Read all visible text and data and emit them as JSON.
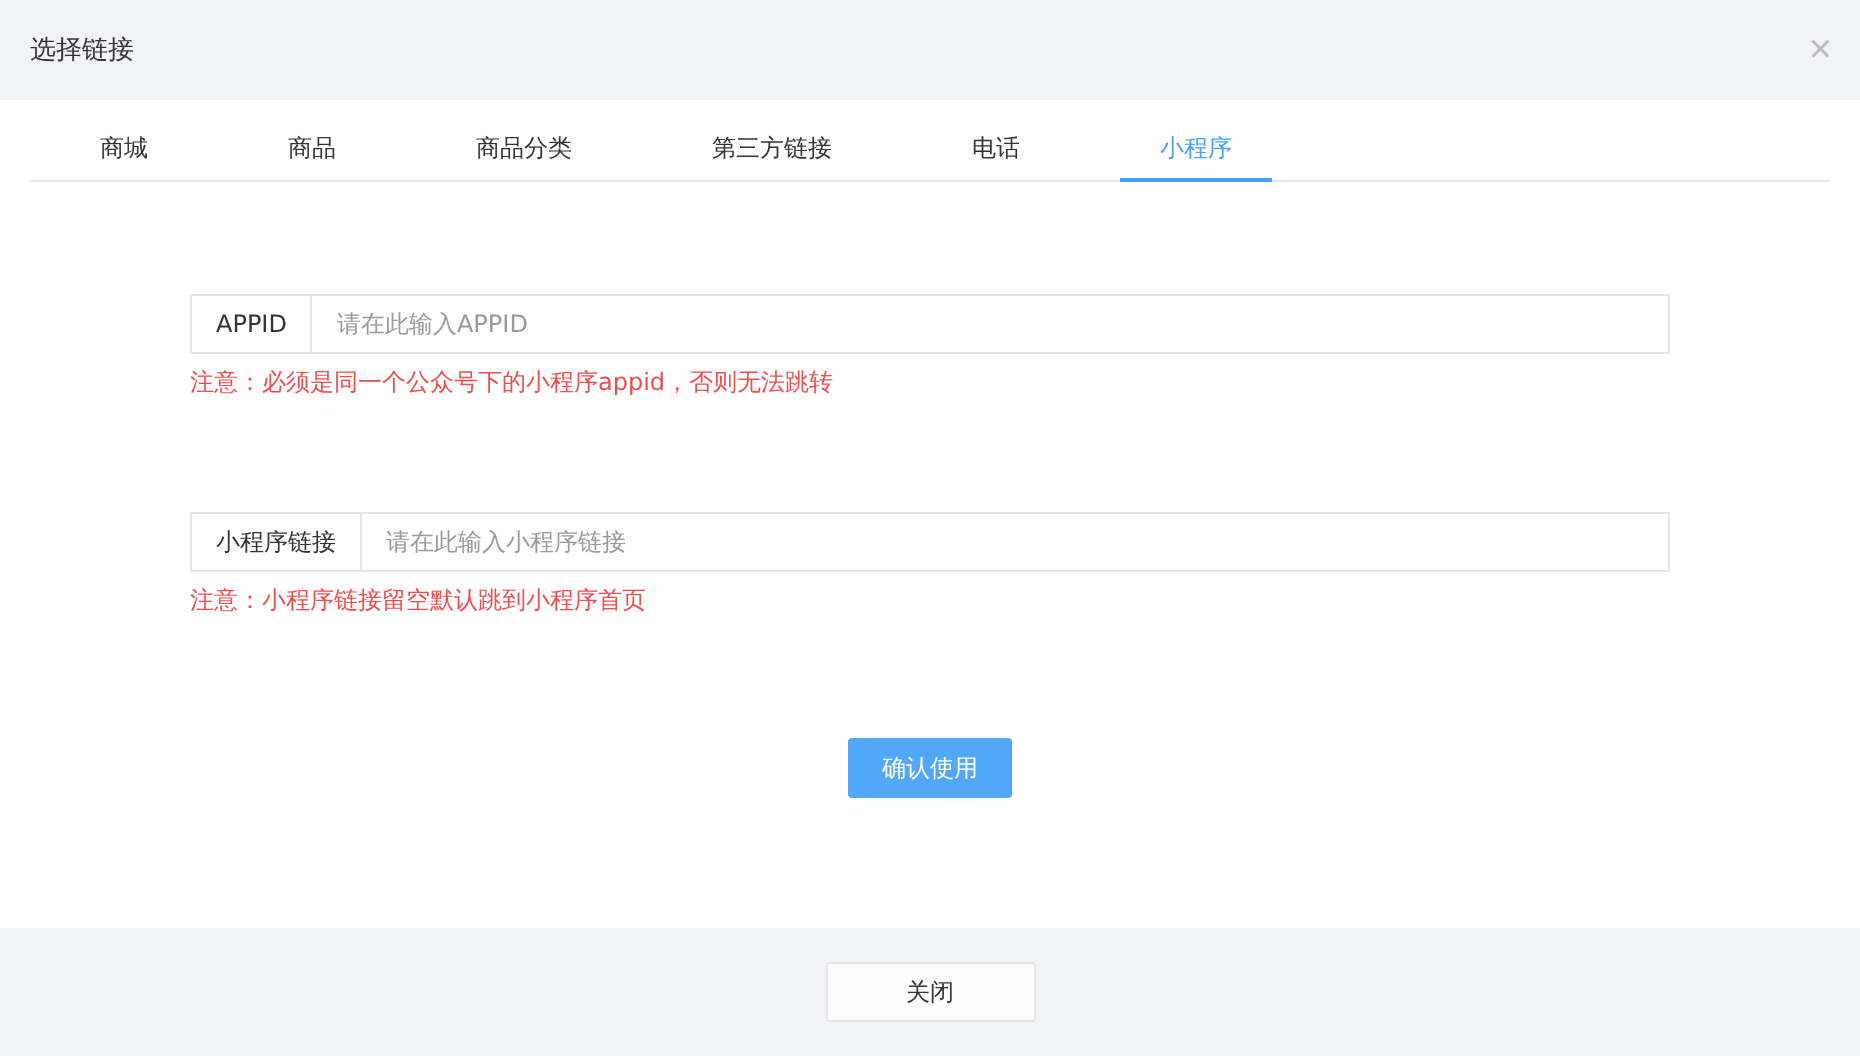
{
  "dialog": {
    "title": "选择链接",
    "close_icon": "×"
  },
  "tabs": [
    {
      "label": "商城",
      "selected": false
    },
    {
      "label": "商品",
      "selected": false
    },
    {
      "label": "商品分类",
      "selected": false
    },
    {
      "label": "第三方链接",
      "selected": false
    },
    {
      "label": "电话",
      "selected": false
    },
    {
      "label": "小程序",
      "selected": true
    }
  ],
  "fields": [
    {
      "label": "APPID",
      "placeholder": "请在此输入APPID",
      "note": "注意：必须是同一个公众号下的小程序appid，否则无法跳转"
    },
    {
      "label": "小程序链接",
      "placeholder": "请在此输入小程序链接",
      "note": "注意：小程序链接留空默认跳到小程序首页"
    }
  ],
  "confirm_button": "确认使用",
  "footer": {
    "close_button": "关闭"
  }
}
